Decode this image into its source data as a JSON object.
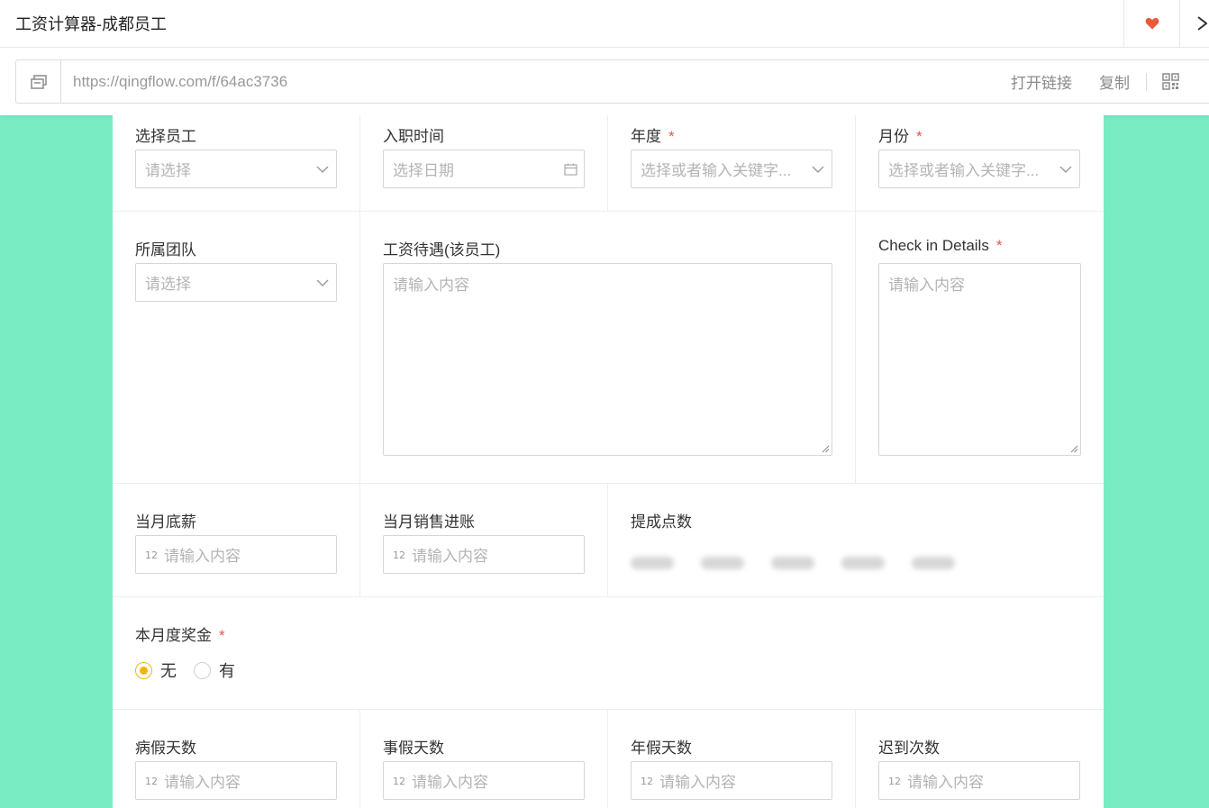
{
  "window": {
    "title": "工资计算器-成都员工"
  },
  "urlbar": {
    "url": "https://qingflow.com/f/64ac3736",
    "open_link_label": "打开链接",
    "copy_label": "复制"
  },
  "colors": {
    "background": "#79ecc4",
    "accent": "#f0b60f",
    "required": "#e8564a",
    "favorite": "#e85a3a"
  },
  "form": {
    "employee": {
      "label": "选择员工",
      "placeholder": "请选择"
    },
    "hire_date": {
      "label": "入职时间",
      "placeholder": "选择日期"
    },
    "year": {
      "label": "年度",
      "required_mark": "*",
      "placeholder": "选择或者输入关键字..."
    },
    "month": {
      "label": "月份",
      "required_mark": "*",
      "placeholder": "选择或者输入关键字..."
    },
    "team": {
      "label": "所属团队",
      "placeholder": "请选择"
    },
    "salary_terms": {
      "label": "工资待遇(该员工)",
      "placeholder": "请输入内容"
    },
    "checkin_details": {
      "label": "Check in Details",
      "required_mark": "*",
      "placeholder": "请输入内容"
    },
    "base_salary": {
      "label": "当月底薪",
      "placeholder": "请输入内容"
    },
    "sales_income": {
      "label": "当月销售进账",
      "placeholder": "请输入内容"
    },
    "commission": {
      "label": "提成点数"
    },
    "annual_bonus": {
      "label": "本月度奖金",
      "required_mark": "*",
      "options": [
        {
          "label": "无",
          "selected": true
        },
        {
          "label": "有",
          "selected": false
        }
      ]
    },
    "sick_days": {
      "label": "病假天数",
      "placeholder": "请输入内容"
    },
    "personal_days": {
      "label": "事假天数",
      "placeholder": "请输入内容"
    },
    "annual_days": {
      "label": "年假天数",
      "placeholder": "请输入内容"
    },
    "late_count": {
      "label": "迟到次数",
      "placeholder": "请输入内容"
    }
  }
}
